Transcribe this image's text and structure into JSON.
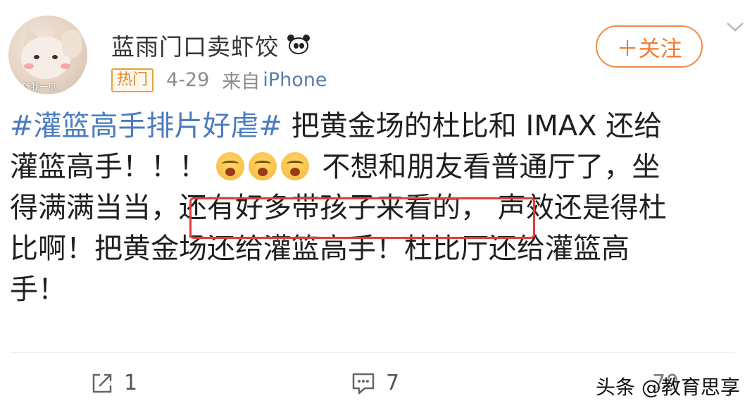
{
  "post": {
    "username": "蓝雨门口卖虾饺",
    "badge": "热门",
    "time": "4-29",
    "source_prefix": "来自",
    "source_app": "iPhone",
    "follow_label": "＋关注",
    "avatar_caption": "吃我一爪",
    "lines": [
      {
        "hashtag": "#灌篮高手排片好虐#",
        "text": " 把黄金场的杜比和 IMAX 还给"
      },
      {
        "text_before": "灌篮高手！！！ ",
        "emoji_name": "angry-face-icon",
        "emoji_count": 3,
        "text_after": " 不想和朋友看普通厅了，坐"
      },
      {
        "text_before": "得满满当当，",
        "highlight": "还有好多带孩子来看的，",
        "text_after": " 声效还是得杜"
      },
      {
        "text": "比啊！把黄金场还给灌篮高手！杜比厅还给灌篮高"
      },
      {
        "text": "手！"
      }
    ]
  },
  "actions": {
    "repost_count": "1",
    "comment_count": "7",
    "like_count": "70"
  },
  "watermark": "头条 @教育思享",
  "colors": {
    "hashtag": "#4a7cc0",
    "follow": "#f27a31",
    "highlight_border": "#e23b3b",
    "badge": "#e6a23c"
  }
}
